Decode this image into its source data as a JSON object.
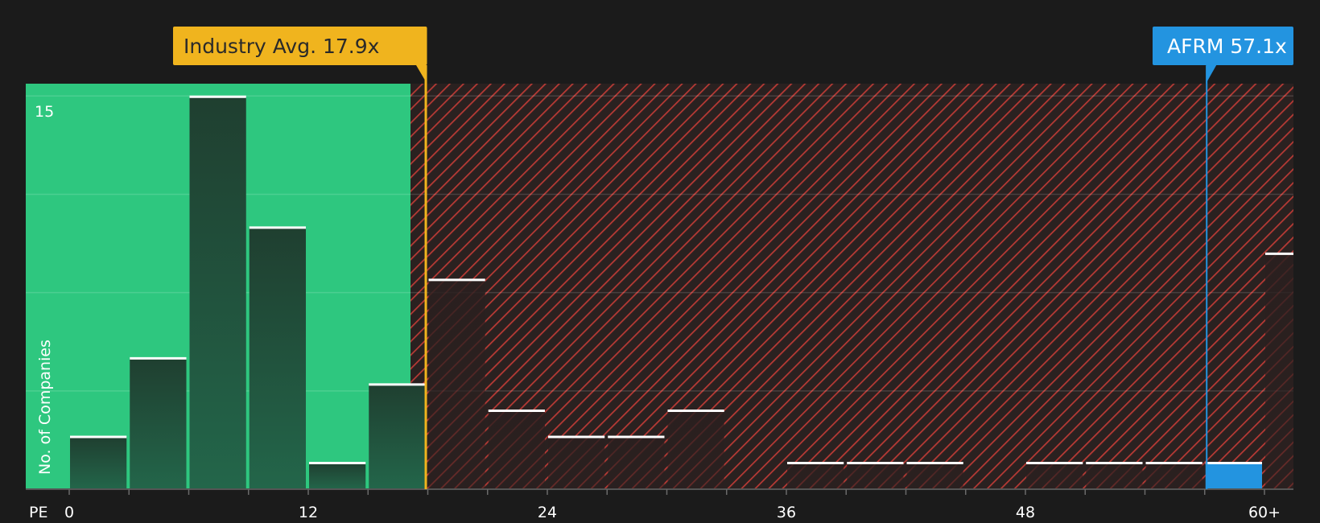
{
  "chart_data": {
    "type": "bar",
    "title": "",
    "xlabel": "PE",
    "ylabel": "No. of Companies",
    "x_ticks": [
      "0",
      "12",
      "24",
      "36",
      "48",
      "60+"
    ],
    "y_ticks": [
      "15"
    ],
    "ylim": [
      0,
      15.5
    ],
    "bin_width": 3,
    "bins_start": [
      0,
      3,
      6,
      9,
      12,
      15,
      18,
      21,
      24,
      27,
      30,
      33,
      36,
      39,
      42,
      45,
      48,
      51,
      54,
      57,
      60
    ],
    "values": [
      2,
      5,
      15,
      10,
      1,
      4,
      8,
      3,
      2,
      2,
      3,
      0,
      1,
      1,
      1,
      0,
      1,
      1,
      1,
      1,
      9
    ],
    "industry_avg": {
      "label": "Industry Avg. 17.9x",
      "value": 17.9
    },
    "company": {
      "label": "AFRM 57.1x",
      "value": 57.1,
      "bin_index": 19
    },
    "colors": {
      "background": "#1b1b1b",
      "undervalued": "#2ec77f",
      "overvalued": "#b83a35",
      "bar_dark": "#1f3d31",
      "industry": "#f0b41e",
      "company": "#2394e0"
    }
  }
}
